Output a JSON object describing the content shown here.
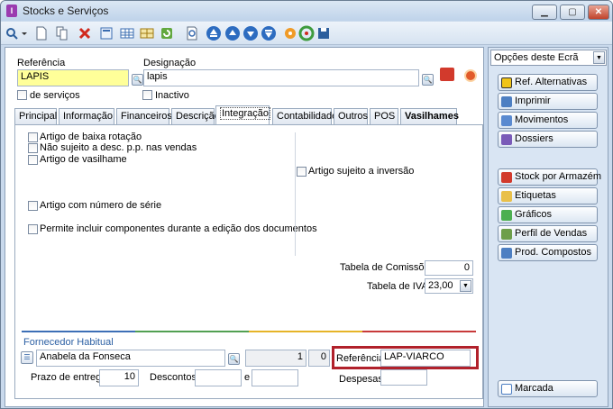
{
  "window": {
    "title": "Stocks e Serviços",
    "controls": {
      "minimize": "▁",
      "maximize": "▢",
      "close": "✕"
    }
  },
  "toolbar": {
    "icons": [
      "search-icon",
      "new-icon",
      "copy-icon",
      "delete-icon",
      "properties-icon",
      "table-icon",
      "grid-icon",
      "refresh-icon",
      "preview-icon",
      "first-icon",
      "prev-icon",
      "next-icon",
      "last-icon",
      "tools-icon",
      "sync-icon",
      "save-icon"
    ]
  },
  "header": {
    "referencia_label": "Referência",
    "referencia_value": "LAPIS",
    "designacao_label": "Designação",
    "designacao_value": "lapis",
    "servicos_label": "de serviços",
    "inactivo_label": "Inactivo"
  },
  "tabs": [
    "Principal",
    "Informação",
    "Financeiros",
    "Descrição",
    "Integração",
    "Contabilidade",
    "Outros",
    "POS",
    "Vasilhames"
  ],
  "active_tab": "Integração",
  "integracao": {
    "checkboxes_left": [
      "Artigo de baixa rotação",
      "Não sujeito a desc. p.p. nas vendas",
      "Artigo de vasilhame"
    ],
    "numero_serie": "Artigo com número de série",
    "componentes": "Permite incluir componentes durante a edição dos documentos",
    "inversao": "Artigo sujeito a inversão",
    "tabela_comissoes_label": "Tabela de Comissões",
    "tabela_comissoes_value": "0",
    "tabela_iva_label": "Tabela de IVA",
    "tabela_iva_value": "23,00"
  },
  "fornecedor": {
    "section_label": "Fornecedor Habitual",
    "name": "Anabela da Fonseca",
    "value1": "1",
    "value2": "0",
    "referencia_label": "Referência",
    "referencia_value": "LAP-VIARCO",
    "prazo_label": "Prazo de entrega",
    "prazo_value": "10",
    "descontos_label": "Descontos",
    "e_label": "e",
    "despesas_label": "Despesas"
  },
  "side": {
    "combo": "Opções deste Ecrã",
    "group1": [
      "Ref. Alternativas",
      "Imprimir",
      "Movimentos",
      "Dossiers"
    ],
    "group2": [
      "Stock por Armazém",
      "Etiquetas",
      "Gráficos",
      "Perfil de Vendas",
      "Prod. Compostos"
    ],
    "marcada": "Marcada"
  },
  "colors": {
    "accent": "#b1212b",
    "yellow_field": "#ffff99",
    "section_blue": "#2b5fa3"
  }
}
